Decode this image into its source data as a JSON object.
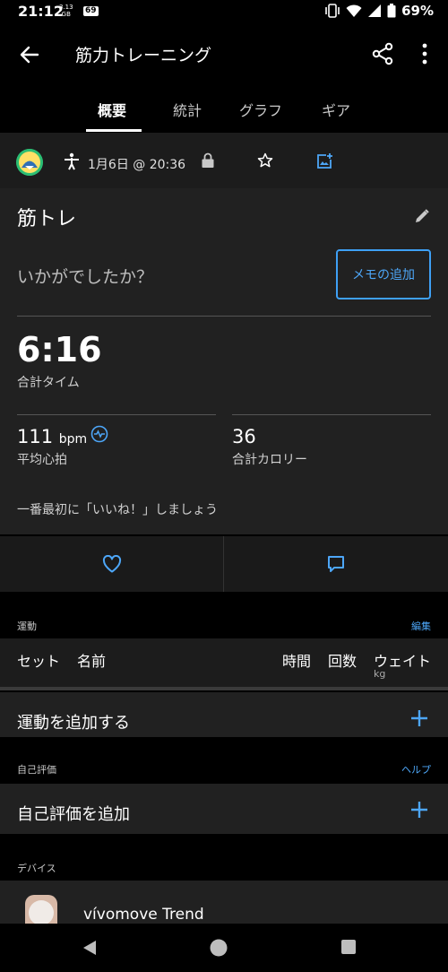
{
  "status_bar": {
    "time": "21:12",
    "data_speed_value": "3.13",
    "data_speed_unit": "GB",
    "badge": "69",
    "battery": "69%"
  },
  "app_bar": {
    "title": "筋力トレーニング"
  },
  "tabs": [
    {
      "label": "概要",
      "active": true
    },
    {
      "label": "統計",
      "active": false
    },
    {
      "label": "グラフ",
      "active": false
    },
    {
      "label": "ギア",
      "active": false
    }
  ],
  "meta": {
    "date": "1月6日 @ 20:36"
  },
  "activity": {
    "name": "筋トレ",
    "prompt": "いかがでしたか？",
    "memo_button": "メモの追加",
    "total_time": "6:16",
    "total_time_label": "合計タイム",
    "avg_hr_value": "111",
    "avg_hr_unit": "bpm",
    "avg_hr_label": "平均心拍",
    "calories_value": "36",
    "calories_label": "合計カロリー",
    "like_prompt": "一番最初に「いいね！」しましょう"
  },
  "exercise_section": {
    "title": "運動",
    "link": "編集",
    "columns": {
      "set": "セット",
      "name": "名前",
      "time": "時間",
      "reps": "回数",
      "weight": "ウェイト",
      "weight_unit": "kg"
    },
    "add_label": "運動を追加する"
  },
  "self_eval_section": {
    "title": "自己評価",
    "link": "ヘルプ",
    "add_label": "自己評価を追加"
  },
  "device_section": {
    "title": "デバイス",
    "device_name": "vívomove Trend"
  },
  "colors": {
    "accent": "#3ea0f5",
    "background": "#000000",
    "card": "#212121"
  }
}
